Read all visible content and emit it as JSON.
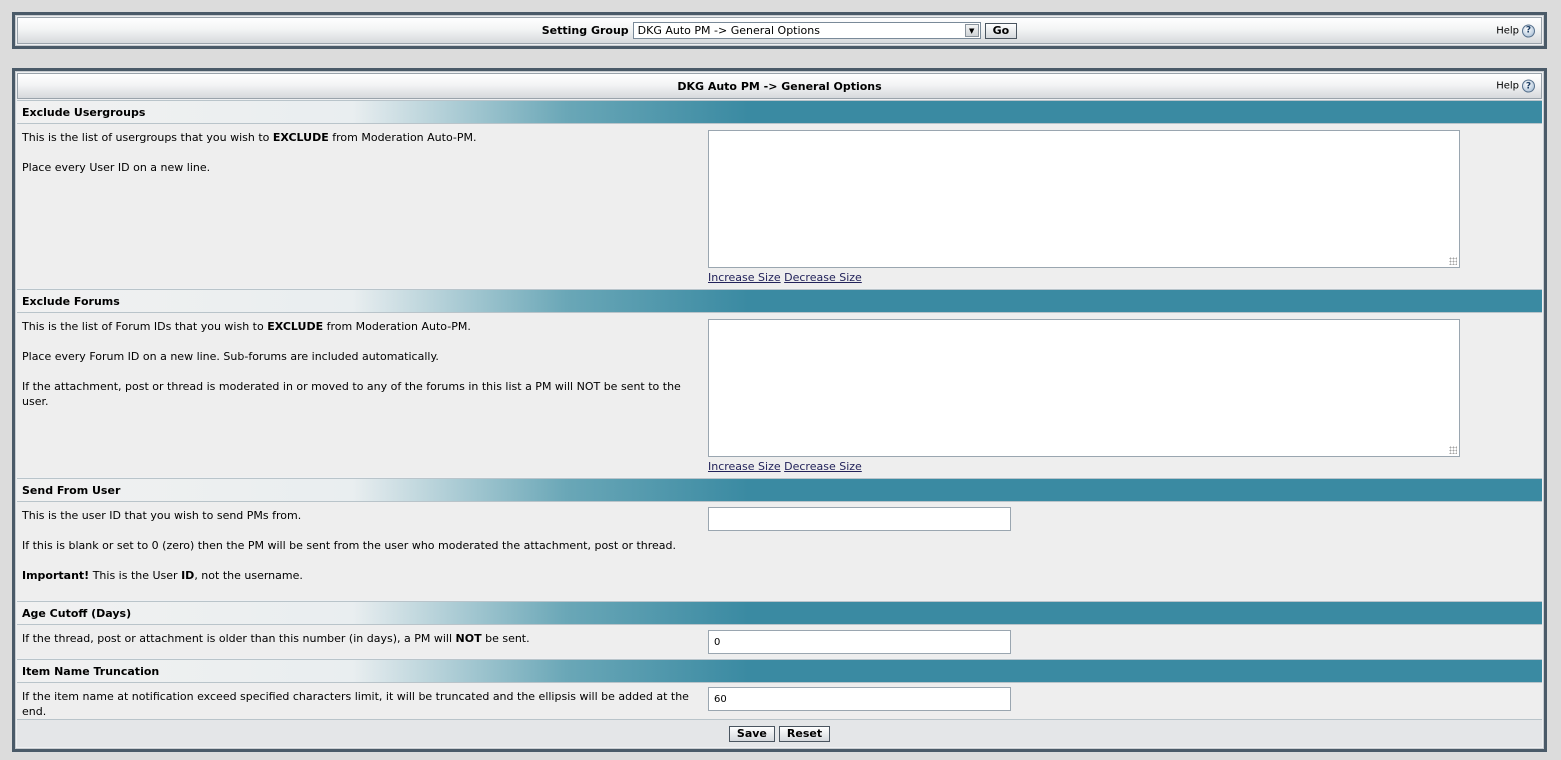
{
  "topbar": {
    "label": "Setting Group",
    "selected": "DKG Auto PM -> General Options",
    "go_label": "Go",
    "help_label": "Help",
    "help_glyph": "?"
  },
  "panel": {
    "title": "DKG Auto PM -> General Options",
    "help_label": "Help",
    "help_glyph": "?"
  },
  "sections": [
    {
      "title": "Exclude Usergroups",
      "desc": [
        {
          "before": "This is the list of usergroups that you wish to ",
          "bold": "EXCLUDE",
          "after": " from Moderation Auto-PM."
        },
        {
          "text": "Place every User ID on a new line."
        }
      ],
      "increase": "Increase Size",
      "decrease": "Decrease Size"
    },
    {
      "title": "Exclude Forums",
      "desc": [
        {
          "before": "This is the list of Forum IDs that you wish to ",
          "bold": "EXCLUDE",
          "after": " from Moderation Auto-PM."
        },
        {
          "text": "Place every Forum ID on a new line. Sub-forums are included automatically."
        },
        {
          "text": "If the attachment, post or thread is moderated in or moved to any of the forums in this list a PM will NOT be sent to the user."
        }
      ],
      "increase": "Increase Size",
      "decrease": "Decrease Size"
    },
    {
      "title": "Send From User",
      "desc": [
        {
          "text": "This is the user ID that you wish to send PMs from."
        },
        {
          "text": "If this is blank or set to 0 (zero) then the PM will be sent from the user who moderated the attachment, post or thread."
        },
        {
          "bold_lead": "Important!",
          "mid": " This is the User ",
          "bold2": "ID",
          "end": ", not the username."
        }
      ],
      "value": ""
    },
    {
      "title": "Age Cutoff (Days)",
      "desc": [
        {
          "before": "If the thread, post or attachment is older than this number (in days), a PM will ",
          "bold": "NOT",
          "after": " be sent."
        }
      ],
      "value": "0"
    },
    {
      "title": "Item Name Truncation",
      "desc": [
        {
          "text": "If the item name at notification exceed specified characters limit, it will be truncated and the ellipsis will be added at the end."
        }
      ],
      "value": "60"
    }
  ],
  "footer": {
    "save_label": "Save",
    "reset_label": "Reset"
  }
}
